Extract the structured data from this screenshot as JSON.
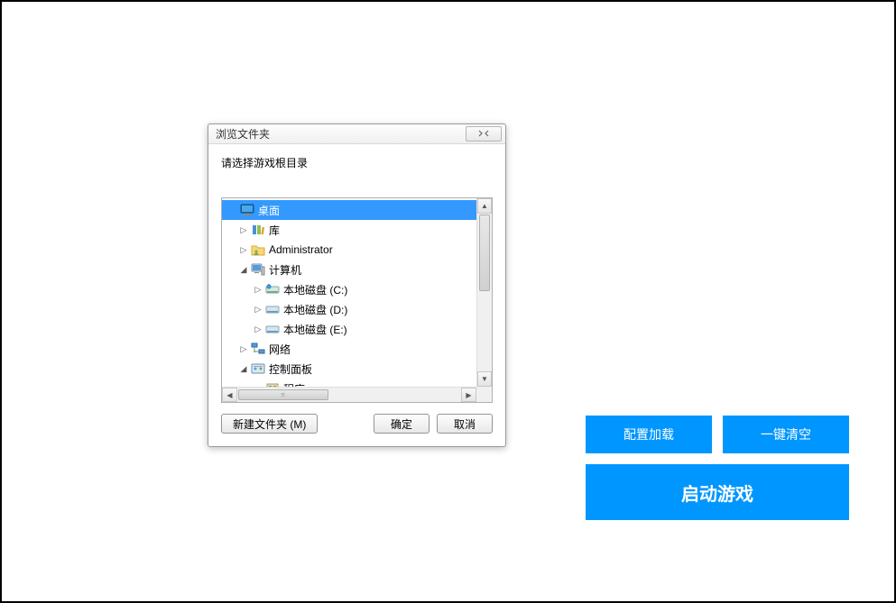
{
  "dialog": {
    "title": "浏览文件夹",
    "close_label": "✕",
    "instruction": "请选择游戏根目录",
    "tree": {
      "desktop": "桌面",
      "libraries": "库",
      "administrator": "Administrator",
      "computer": "计算机",
      "disk_c": "本地磁盘 (C:)",
      "disk_d": "本地磁盘 (D:)",
      "disk_e": "本地磁盘 (E:)",
      "network": "网络",
      "control_panel": "控制面板",
      "programs": "程序"
    },
    "buttons": {
      "new_folder": "新建文件夹 (M)",
      "ok": "确定",
      "cancel": "取消"
    }
  },
  "launcher": {
    "load_config": "配置加载",
    "clear_all": "一键清空",
    "start_game": "启动游戏"
  }
}
